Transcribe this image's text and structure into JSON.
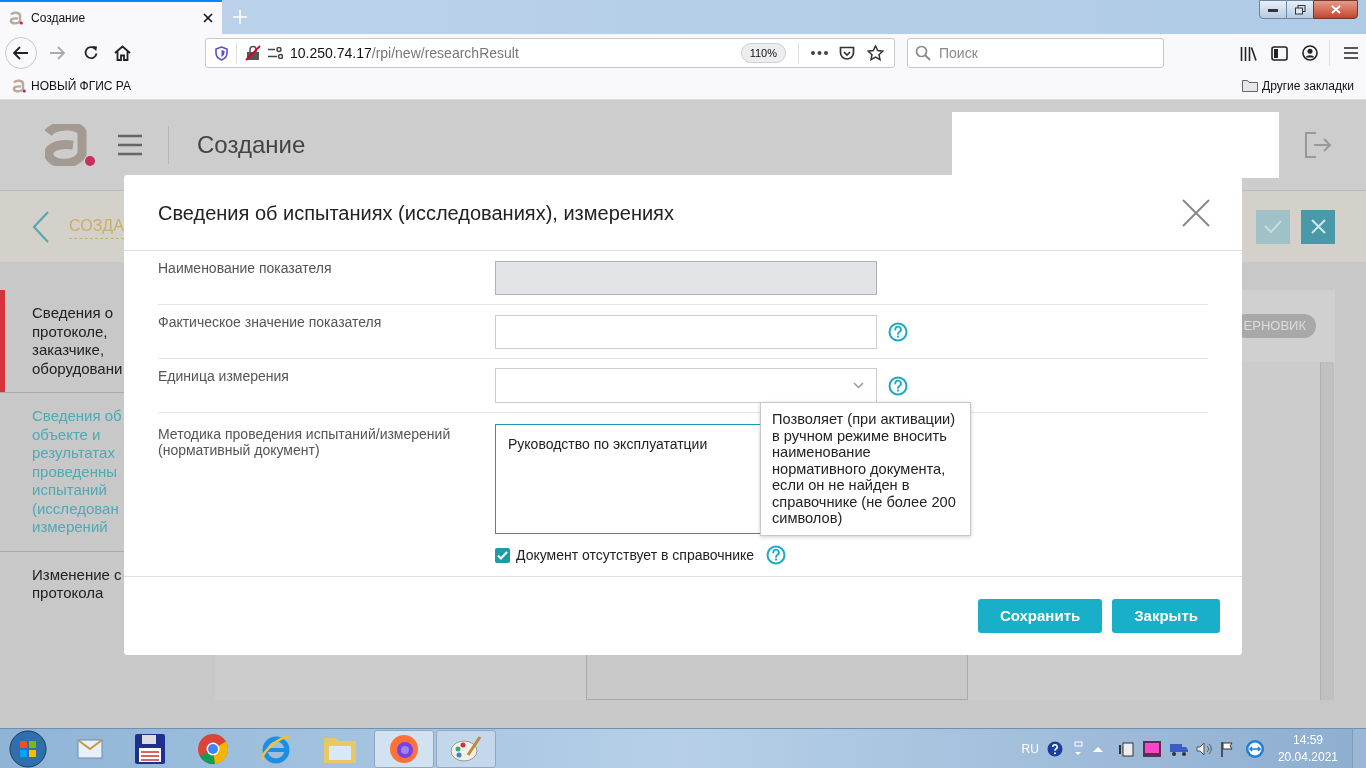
{
  "browser": {
    "tab": {
      "title": "Создание"
    },
    "address": {
      "host": "10.250.74.17",
      "path": "/rpi/new/researchResult"
    },
    "zoom": "110%",
    "search": {
      "placeholder": "Поиск"
    },
    "bookmarks": [
      {
        "label": "НОВЫЙ ФГИС РА"
      }
    ],
    "other_bookmarks": "Другие закладки"
  },
  "page": {
    "header_title": "Создание",
    "breadcrumb": "СОЗДА",
    "status_badge": "ЕРНОВИК",
    "sidebar": [
      {
        "lines": [
          "Сведения о",
          "протоколе,",
          "заказчике,",
          "оборудовани"
        ],
        "selected": false,
        "flagged": true
      },
      {
        "lines": [
          "Сведения об",
          "объекте и",
          "результатах",
          "проведенны",
          "испытаний",
          "(исследован",
          "измерений"
        ],
        "selected": true,
        "flagged": false
      },
      {
        "lines": [
          "Изменение с",
          "протокола"
        ],
        "selected": false,
        "flagged": false
      }
    ]
  },
  "dialog": {
    "title": "Сведения об испытаниях (исследованиях), измерениях",
    "fields": [
      {
        "label": "Наименование показателя",
        "kind": "text",
        "disabled": true,
        "help": false
      },
      {
        "label": "Фактическое значение показателя",
        "kind": "text",
        "disabled": false,
        "help": true
      },
      {
        "label": "Единица измерения",
        "kind": "select",
        "disabled": false,
        "help": true
      },
      {
        "label": "Методика проведения испытаний/измерений (нормативный документ)",
        "kind": "textarea",
        "disabled": false,
        "help": false,
        "value": "Руководство по эксплуататции"
      }
    ],
    "checkbox": {
      "label": "Документ отсутствует в справочнике",
      "checked": true,
      "help": true,
      "tooltip": "Позволяет (при активации) в ручном режиме вносить наименование нормативного документа, если он не найден в справочнике (не более 200 символов)"
    },
    "buttons": [
      "Сохранить",
      "Закрыть"
    ]
  },
  "taskbar": {
    "language": "RU",
    "time": "14:59",
    "date": "20.04.2021"
  }
}
